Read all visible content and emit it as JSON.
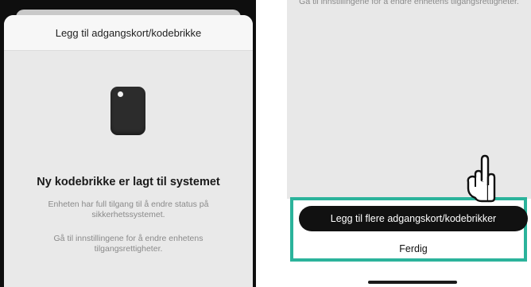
{
  "left_screen": {
    "sheet_title": "Legg til adgangskort/kodebrikke",
    "device_icon": "keyfob-tag-icon",
    "headline": "Ny kodebrikke er lagt til systemet",
    "description_access": "Enheten har full tilgang til å endre status på sikkerhetssystemet.",
    "description_settings": "Gå til innstillingene for å endre enhetens tilgangsrettigheter."
  },
  "right_screen": {
    "description_settings": "Gå til innstillingene for å endre enhetens tilgangsrettigheter.",
    "add_more_button": "Legg til flere adgangskort/kodebrikker",
    "done_button": "Ferdig",
    "pointer_icon": "hand-pointer-icon",
    "highlight_color": "#2bb39b"
  },
  "colors": {
    "primary_button": "#111111",
    "muted_text": "#8a8a8a",
    "highlight": "#2bb39b"
  }
}
